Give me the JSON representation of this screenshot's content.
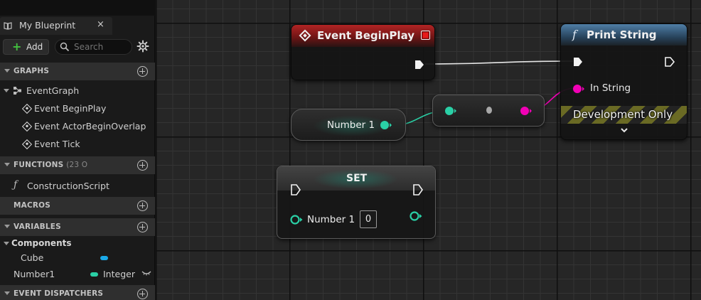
{
  "panel": {
    "tab_title": "My Blueprint",
    "tab_close": "×",
    "add_label": "Add",
    "search_placeholder": "Search",
    "sections": {
      "graphs": "GRAPHS",
      "functions": "FUNCTIONS",
      "functions_count": "(23 O",
      "macros": "MACROS",
      "variables": "VARIABLES",
      "event_dispatchers": "EVENT DISPATCHERS"
    },
    "graphs": {
      "event_graph": "EventGraph",
      "events": [
        "Event BeginPlay",
        "Event ActorBeginOverlap",
        "Event Tick"
      ]
    },
    "functions": [
      "ConstructionScript"
    ],
    "variables": {
      "category": "Components",
      "items": [
        {
          "name": "Cube",
          "type": "",
          "color": "#1aa9e8"
        },
        {
          "name": "Number1",
          "type": "Integer",
          "color": "#2ad0a6"
        }
      ]
    }
  },
  "graph": {
    "event_begin_play": {
      "title": "Event BeginPlay",
      "color": "#b22424"
    },
    "print_string": {
      "title": "Print String",
      "in_string_label": "In String",
      "development_label": "Development Only",
      "color": "#4f7ea6"
    },
    "var_get": {
      "label": "Number 1"
    },
    "set_node": {
      "title": "SET",
      "pin_label": "Number 1",
      "value": "0"
    },
    "pin_colors": {
      "integer": "#2ad0a6",
      "string": "#f100b5",
      "exec": "#f2f2f2"
    }
  }
}
